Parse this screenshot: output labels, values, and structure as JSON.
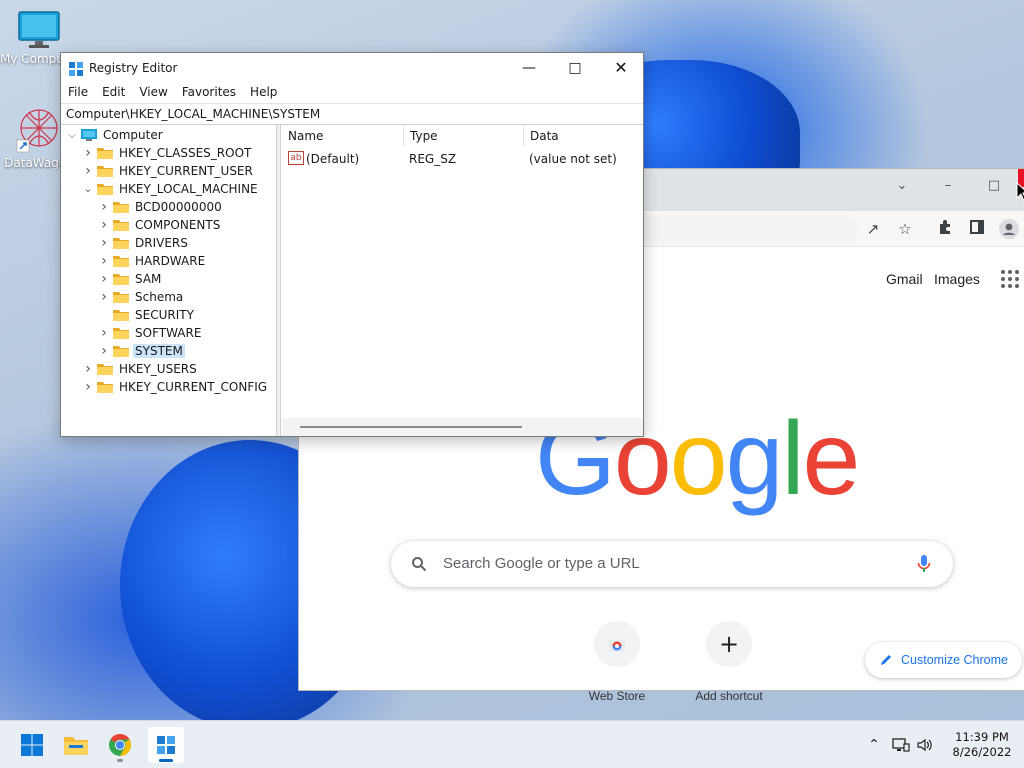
{
  "desktop": {
    "icons": [
      {
        "label": "My Computer"
      },
      {
        "label": "DataWagon"
      }
    ]
  },
  "registry_editor": {
    "title": "Registry Editor",
    "menu": [
      "File",
      "Edit",
      "View",
      "Favorites",
      "Help"
    ],
    "address": "Computer\\HKEY_LOCAL_MACHINE\\SYSTEM",
    "tree": {
      "root": "Computer",
      "hives": [
        "HKEY_CLASSES_ROOT",
        "HKEY_CURRENT_USER",
        "HKEY_LOCAL_MACHINE"
      ],
      "hklm_children": [
        "BCD00000000",
        "COMPONENTS",
        "DRIVERS",
        "HARDWARE",
        "SAM",
        "Schema",
        "SECURITY",
        "SOFTWARE",
        "SYSTEM"
      ],
      "after": [
        "HKEY_USERS",
        "HKEY_CURRENT_CONFIG"
      ],
      "selected": "SYSTEM"
    },
    "columns": [
      "Name",
      "Type",
      "Data"
    ],
    "values": [
      {
        "name": "(Default)",
        "type": "REG_SZ",
        "data": "(value not set)"
      }
    ]
  },
  "chrome": {
    "top_links": [
      "Gmail",
      "Images"
    ],
    "logo": [
      "G",
      "o",
      "o",
      "g",
      "l",
      "e"
    ],
    "logo_colors": [
      "#4285F4",
      "#EA4335",
      "#FBBC05",
      "#4285F4",
      "#34A853",
      "#EA4335"
    ],
    "search_placeholder": "Search Google or type a URL",
    "shortcuts": [
      "Web Store",
      "Add shortcut"
    ],
    "customize_label": "Customize Chrome"
  },
  "taskbar": {
    "apps": [
      "start-icon",
      "file-explorer-icon",
      "chrome-icon",
      "registry-editor-icon"
    ],
    "time": "11:39 PM",
    "date": "8/26/2022"
  }
}
